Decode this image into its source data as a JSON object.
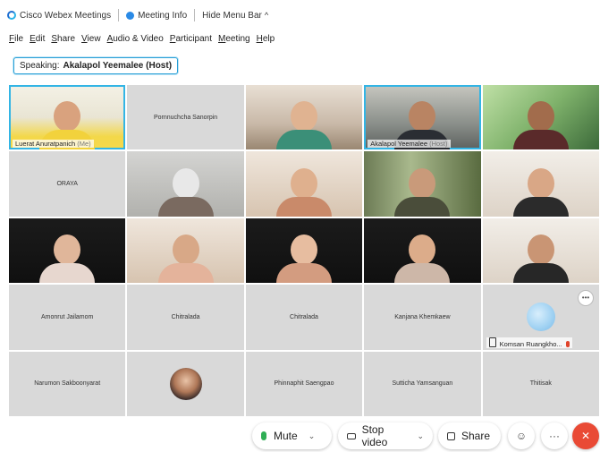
{
  "topbar": {
    "app_name": "Cisco Webex Meetings",
    "meeting_info": "Meeting Info",
    "hide_menu_bar": "Hide Menu Bar"
  },
  "menu": [
    "File",
    "Edit",
    "Share",
    "View",
    "Audio & Video",
    "Participant",
    "Meeting",
    "Help"
  ],
  "speaking": {
    "label": "Speaking:",
    "name": "Akalapol Yeemalee (Host)"
  },
  "participants": [
    {
      "name": "Luerat Anuratpanich",
      "suffix": "(Me)"
    },
    {
      "name": "Pornnuchcha Sanorpin"
    },
    {
      "name": ""
    },
    {
      "name": "Akalapol Yeemalee",
      "suffix": "(Host)"
    },
    {
      "name": ""
    },
    {
      "name": "ORAYA"
    },
    {
      "name": "Amonrut Jailamom"
    },
    {
      "name": "Chitralada"
    },
    {
      "name": "Chitralada"
    },
    {
      "name": "Kanjana Khemkaew"
    },
    {
      "name": "Komsan Ruangkho..."
    },
    {
      "name": "Narumon Sakboonyarat"
    },
    {
      "name": "Phinnaphit Saengpao"
    },
    {
      "name": "Sutticha Yamsanguan"
    },
    {
      "name": "Thitisak"
    }
  ],
  "controls": {
    "mute": "Mute",
    "stop_video": "Stop video",
    "share": "Share"
  },
  "colors": {
    "active_speaker": "#33b5e5",
    "end_call": "#e94a35",
    "mic_on": "#2fae55"
  }
}
